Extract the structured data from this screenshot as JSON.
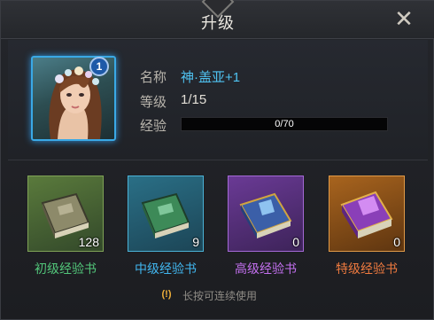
{
  "dialog": {
    "title": "升级"
  },
  "hero": {
    "badge": "1",
    "name_label": "名称",
    "name": "神·盖亚+1",
    "level_label": "等级",
    "level": "1/15",
    "exp_label": "经验",
    "exp_text": "0/70",
    "exp_progress": 0
  },
  "books": [
    {
      "label": "初级经验书",
      "count": "128",
      "color": "#52c67a"
    },
    {
      "label": "中级经验书",
      "count": "9",
      "color": "#41b6ef"
    },
    {
      "label": "高级经验书",
      "count": "0",
      "color": "#c370ef"
    },
    {
      "label": "特级经验书",
      "count": "0",
      "color": "#ef7a3f"
    }
  ],
  "hint": {
    "icon": "(!)",
    "text": "长按可连续使用"
  },
  "icons": {
    "close": "close-icon"
  }
}
